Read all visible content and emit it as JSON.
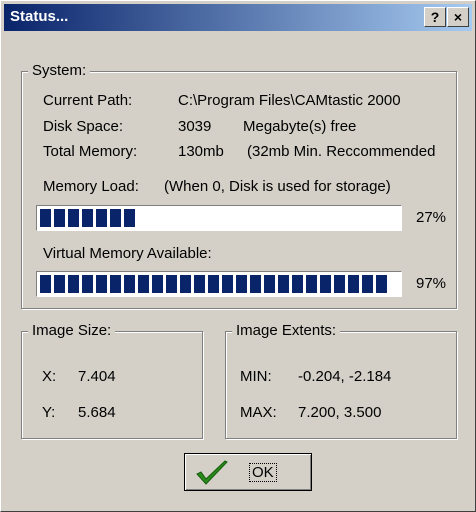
{
  "window": {
    "title": "Status...",
    "help_label": "?",
    "close_label": "×"
  },
  "system": {
    "legend": "System:",
    "current_path_label": "Current Path:",
    "current_path_value": "C:\\Program Files\\CAMtastic 2000",
    "disk_space_label": "Disk Space:",
    "disk_space_value": "3039",
    "disk_space_unit": "Megabyte(s) free",
    "total_memory_label": "Total Memory:",
    "total_memory_value": "130mb",
    "total_memory_note": "(32mb Min. Reccommended",
    "memory_load_label": "Memory Load:",
    "memory_load_note": "(When 0, Disk is used for storage)",
    "memory_load_percent": 27,
    "memory_load_percent_text": "27%",
    "virtual_memory_label": "Virtual Memory Available:",
    "virtual_memory_percent": 97,
    "virtual_memory_percent_text": "97%"
  },
  "image_size": {
    "legend": "Image Size:",
    "x_label": "X:",
    "x_value": "7.404",
    "y_label": "Y:",
    "y_value": "5.684"
  },
  "image_extents": {
    "legend": "Image Extents:",
    "min_label": "MIN:",
    "min_value": "-0.204, -2.184",
    "max_label": "MAX:",
    "max_value": "7.200, 3.500"
  },
  "ok_button": {
    "label": "OK",
    "icon": "check-icon"
  },
  "colors": {
    "title_start": "#0a246a",
    "title_end": "#a6caf0",
    "progress": "#0a246a",
    "face": "#d4d0c8",
    "check": "#2a8a1a"
  }
}
